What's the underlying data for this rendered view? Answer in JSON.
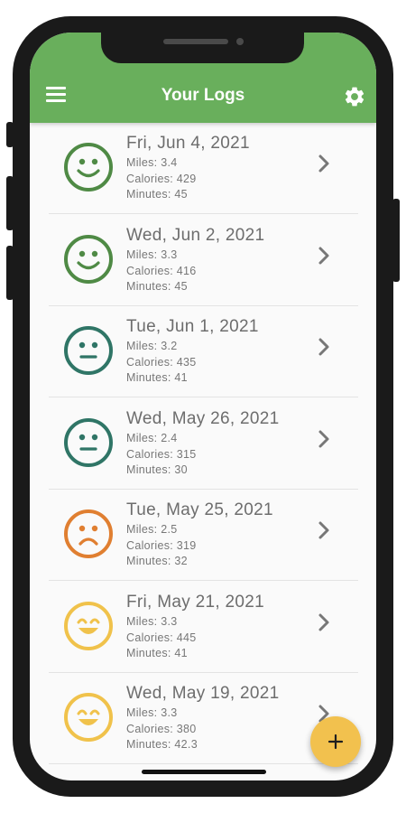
{
  "header": {
    "title": "Your Logs"
  },
  "colors": {
    "appbar": "#69af5c",
    "happy": "#4f8a45",
    "neutral": "#2f7566",
    "sad": "#e07f31",
    "joyful": "#f0c24b",
    "fab": "#f2c14e"
  },
  "icons": {
    "menu": "hamburger-menu-icon",
    "settings": "gear-icon",
    "row_action": "chevron-right-icon",
    "fab": "plus-icon"
  },
  "logs": [
    {
      "date": "Fri, Jun 4, 2021",
      "miles": "Miles: 3.4",
      "calories": "Calories: 429",
      "minutes": "Minutes: 45",
      "mood": "happy"
    },
    {
      "date": "Wed, Jun 2, 2021",
      "miles": "Miles: 3.3",
      "calories": "Calories: 416",
      "minutes": "Minutes: 45",
      "mood": "happy"
    },
    {
      "date": "Tue, Jun 1, 2021",
      "miles": "Miles: 3.2",
      "calories": "Calories: 435",
      "minutes": "Minutes: 41",
      "mood": "neutral"
    },
    {
      "date": "Wed, May 26, 2021",
      "miles": "Miles: 2.4",
      "calories": "Calories: 315",
      "minutes": "Minutes: 30",
      "mood": "neutral"
    },
    {
      "date": "Tue, May 25, 2021",
      "miles": "Miles: 2.5",
      "calories": "Calories: 319",
      "minutes": "Minutes: 32",
      "mood": "sad"
    },
    {
      "date": "Fri, May 21, 2021",
      "miles": "Miles: 3.3",
      "calories": "Calories: 445",
      "minutes": "Minutes: 41",
      "mood": "joyful"
    },
    {
      "date": "Wed, May 19, 2021",
      "miles": "Miles: 3.3",
      "calories": "Calories: 380",
      "minutes": "Minutes: 42.3",
      "mood": "joyful"
    }
  ]
}
